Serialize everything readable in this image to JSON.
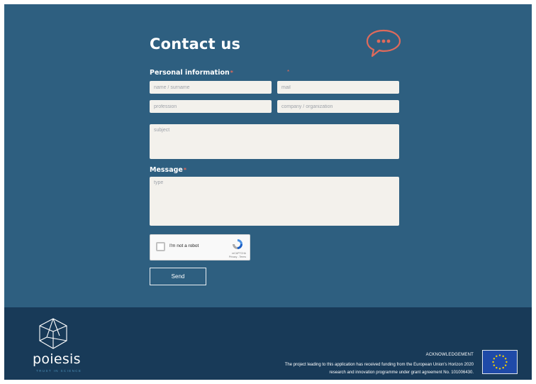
{
  "contact": {
    "title": "Contact us",
    "personal_info_label": "Personal information",
    "required_mark": "*",
    "message_label": "Message",
    "fields": {
      "name_placeholder": "name / surname",
      "mail_placeholder": "mail",
      "profession_placeholder": "profession",
      "company_placeholder": "company / organization",
      "subject_placeholder": "subject",
      "message_placeholder": "type"
    },
    "recaptcha": {
      "label": "I'm not a robot",
      "brand": "reCAPTCHA",
      "links": "Privacy - Terms"
    },
    "send_label": "Send",
    "icons": {
      "chat": "chat-bubble-icon"
    },
    "accent_color": "#e06a5b"
  },
  "footer": {
    "brand": "poiesis",
    "tagline": "TRUST IN SCIENCE",
    "ack_title": "ACKNOWLEDGEMENT",
    "ack_line1": "The project leading to this application has received funding from the European Union's Horizon 2020",
    "ack_line2": "research and innovation programme under grant agreement No. 101006430.",
    "icons": {
      "logo": "poiesis-logo-icon",
      "eu_flag": "eu-flag-icon"
    }
  },
  "colors": {
    "page_bg": "#2e5f80",
    "footer_bg": "#183a58",
    "field_bg": "#f3f1ec"
  }
}
